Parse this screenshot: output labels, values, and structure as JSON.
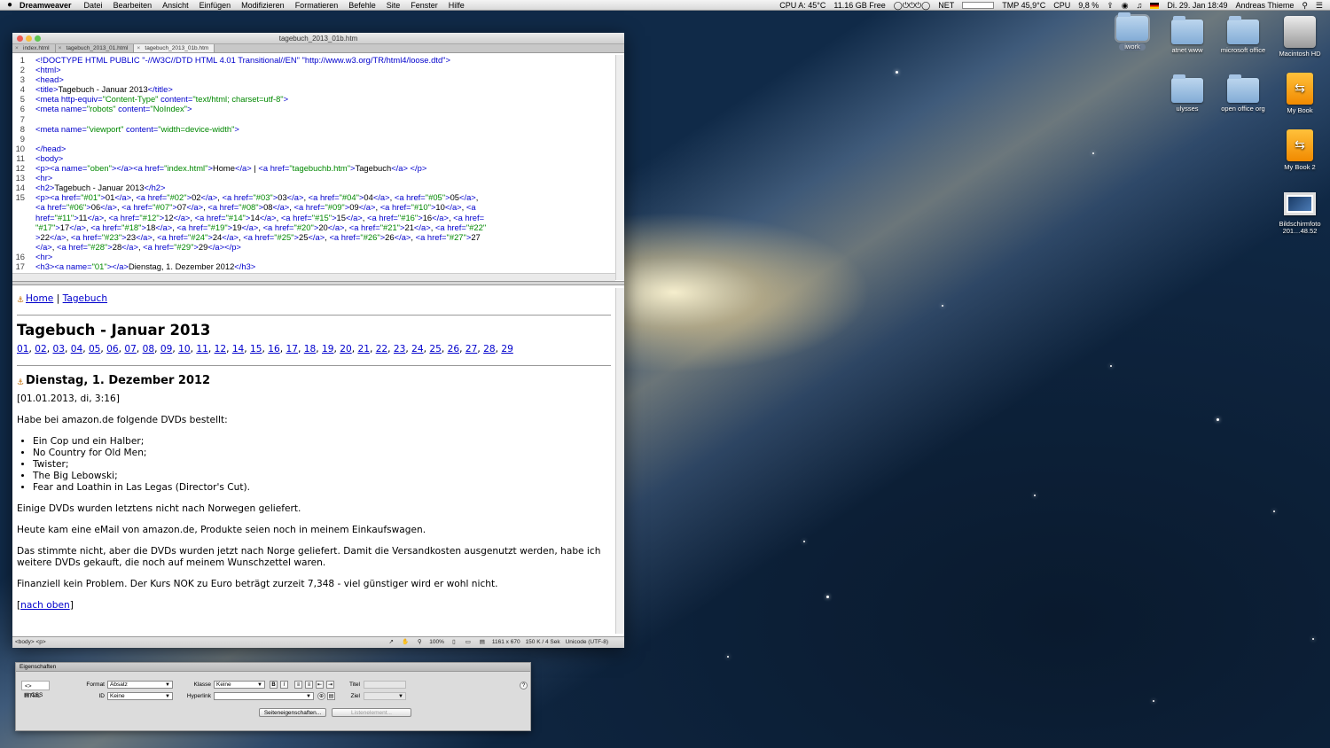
{
  "menubar": {
    "app": "Dreamweaver",
    "items": [
      "Datei",
      "Bearbeiten",
      "Ansicht",
      "Einfügen",
      "Modifizieren",
      "Formatieren",
      "Befehle",
      "Site",
      "Fenster",
      "Hilfe"
    ],
    "status": {
      "cpu_temp": "CPU A: 45°C",
      "disk_free": "11.16 GB Free",
      "net": "NET",
      "tmp": "TMP 45,9°C",
      "cpu": "CPU",
      "cpu_pct": "9,8 %",
      "datetime": "Di. 29. Jan 18:49",
      "user": "Andreas Thieme"
    }
  },
  "desktop": {
    "icons": [
      {
        "label": "iwork",
        "type": "folder",
        "selected": true
      },
      {
        "label": "atnet www",
        "type": "folder"
      },
      {
        "label": "microsoft office",
        "type": "folder"
      },
      {
        "label": "Macintosh HD",
        "type": "drive"
      },
      {
        "label": "ulysses",
        "type": "folder"
      },
      {
        "label": "open office org",
        "type": "folder"
      },
      {
        "label": "My Book",
        "type": "external"
      },
      {
        "label": "My Book 2",
        "type": "external"
      },
      {
        "label": "Bildschirmfoto 201…48.52",
        "type": "screenshot"
      }
    ]
  },
  "window": {
    "title": "tagebuch_2013_01b.htm",
    "tabs": [
      {
        "label": "index.html",
        "active": false
      },
      {
        "label": "tagebuch_2013_01.html",
        "active": false
      },
      {
        "label": "tagebuch_2013_01b.htm",
        "active": true
      }
    ],
    "code_lines": [
      {
        "n": "1",
        "segs": [
          [
            "t",
            "<!DOCTYPE HTML PUBLIC \"-//W3C//DTD HTML 4.01 Transitional//EN\" \"http://www.w3.org/TR/html4/loose.dtd\">"
          ]
        ]
      },
      {
        "n": "2",
        "segs": [
          [
            "t",
            "<html>"
          ]
        ]
      },
      {
        "n": "3",
        "segs": [
          [
            "t",
            "<head>"
          ]
        ]
      },
      {
        "n": "4",
        "segs": [
          [
            "t",
            "<title>"
          ],
          [
            "x",
            "Tagebuch - Januar 2013"
          ],
          [
            "t",
            "</title>"
          ]
        ]
      },
      {
        "n": "5",
        "segs": [
          [
            "t",
            "<meta http-equiv="
          ],
          [
            "s",
            "\"Content-Type\""
          ],
          [
            "t",
            " content="
          ],
          [
            "s",
            "\"text/html; charset=utf-8\""
          ],
          [
            "t",
            ">"
          ]
        ]
      },
      {
        "n": "6",
        "segs": [
          [
            "t",
            "<meta name="
          ],
          [
            "s",
            "\"robots\""
          ],
          [
            "t",
            " content="
          ],
          [
            "s",
            "\"NoIndex\""
          ],
          [
            "t",
            ">"
          ]
        ]
      },
      {
        "n": "7",
        "segs": []
      },
      {
        "n": "8",
        "segs": [
          [
            "t",
            "<meta name="
          ],
          [
            "s",
            "\"viewport\""
          ],
          [
            "t",
            " content="
          ],
          [
            "s",
            "\"width=device-width\""
          ],
          [
            "t",
            ">"
          ]
        ]
      },
      {
        "n": "9",
        "segs": []
      },
      {
        "n": "10",
        "segs": [
          [
            "t",
            "</head>"
          ]
        ]
      },
      {
        "n": "11",
        "segs": [
          [
            "t",
            "<body>"
          ]
        ]
      },
      {
        "n": "12",
        "segs": [
          [
            "t",
            "<p><a name="
          ],
          [
            "s",
            "\"oben\""
          ],
          [
            "t",
            "></a><a href="
          ],
          [
            "s",
            "\"index.html\""
          ],
          [
            "t",
            ">"
          ],
          [
            "x",
            "Home"
          ],
          [
            "t",
            "</a>"
          ],
          [
            "x",
            " | "
          ],
          [
            "t",
            "<a href="
          ],
          [
            "s",
            "\"tagebuchb.htm\""
          ],
          [
            "t",
            ">"
          ],
          [
            "x",
            "Tagebuch"
          ],
          [
            "t",
            "</a> </p>"
          ]
        ]
      },
      {
        "n": "13",
        "segs": [
          [
            "t",
            "<hr>"
          ]
        ]
      },
      {
        "n": "14",
        "segs": [
          [
            "t",
            "<h2>"
          ],
          [
            "x",
            "Tagebuch - Januar 2013"
          ],
          [
            "t",
            "</h2>"
          ]
        ]
      },
      {
        "n": "15",
        "segs": [
          [
            "t",
            "<p><a href="
          ],
          [
            "s",
            "\"#01\""
          ],
          [
            "t",
            ">"
          ],
          [
            "x",
            "01"
          ],
          [
            "t",
            "</a>"
          ],
          [
            "x",
            ", "
          ],
          [
            "t",
            "<a href="
          ],
          [
            "s",
            "\"#02\""
          ],
          [
            "t",
            ">"
          ],
          [
            "x",
            "02"
          ],
          [
            "t",
            "</a>"
          ],
          [
            "x",
            ", "
          ],
          [
            "t",
            "<a href="
          ],
          [
            "s",
            "\"#03\""
          ],
          [
            "t",
            ">"
          ],
          [
            "x",
            "03"
          ],
          [
            "t",
            "</a>"
          ],
          [
            "x",
            ", "
          ],
          [
            "t",
            "<a href="
          ],
          [
            "s",
            "\"#04\""
          ],
          [
            "t",
            ">"
          ],
          [
            "x",
            "04"
          ],
          [
            "t",
            "</a>"
          ],
          [
            "x",
            ", "
          ],
          [
            "t",
            "<a href="
          ],
          [
            "s",
            "\"#05\""
          ],
          [
            "t",
            ">"
          ],
          [
            "x",
            "05"
          ],
          [
            "t",
            "</a>"
          ],
          [
            "x",
            ","
          ]
        ]
      },
      {
        "n": "",
        "segs": [
          [
            "t",
            "<a href="
          ],
          [
            "s",
            "\"#06\""
          ],
          [
            "t",
            ">"
          ],
          [
            "x",
            "06"
          ],
          [
            "t",
            "</a>"
          ],
          [
            "x",
            ", "
          ],
          [
            "t",
            "<a href="
          ],
          [
            "s",
            "\"#07\""
          ],
          [
            "t",
            ">"
          ],
          [
            "x",
            "07"
          ],
          [
            "t",
            "</a>"
          ],
          [
            "x",
            ", "
          ],
          [
            "t",
            "<a href="
          ],
          [
            "s",
            "\"#08\""
          ],
          [
            "t",
            ">"
          ],
          [
            "x",
            "08"
          ],
          [
            "t",
            "</a>"
          ],
          [
            "x",
            ", "
          ],
          [
            "t",
            "<a href="
          ],
          [
            "s",
            "\"#09\""
          ],
          [
            "t",
            ">"
          ],
          [
            "x",
            "09"
          ],
          [
            "t",
            "</a>"
          ],
          [
            "x",
            ", "
          ],
          [
            "t",
            "<a href="
          ],
          [
            "s",
            "\"#10\""
          ],
          [
            "t",
            ">"
          ],
          [
            "x",
            "10"
          ],
          [
            "t",
            "</a>"
          ],
          [
            "x",
            ", "
          ],
          [
            "t",
            "<a"
          ]
        ]
      },
      {
        "n": "",
        "segs": [
          [
            "t",
            "href="
          ],
          [
            "s",
            "\"#11\""
          ],
          [
            "t",
            ">"
          ],
          [
            "x",
            "11"
          ],
          [
            "t",
            "</a>"
          ],
          [
            "x",
            ", "
          ],
          [
            "t",
            "<a href="
          ],
          [
            "s",
            "\"#12\""
          ],
          [
            "t",
            ">"
          ],
          [
            "x",
            "12"
          ],
          [
            "t",
            "</a>"
          ],
          [
            "x",
            ", "
          ],
          [
            "t",
            "<a href="
          ],
          [
            "s",
            "\"#14\""
          ],
          [
            "t",
            ">"
          ],
          [
            "x",
            "14"
          ],
          [
            "t",
            "</a>"
          ],
          [
            "x",
            ", "
          ],
          [
            "t",
            "<a href="
          ],
          [
            "s",
            "\"#15\""
          ],
          [
            "t",
            ">"
          ],
          [
            "x",
            "15"
          ],
          [
            "t",
            "</a>"
          ],
          [
            "x",
            ", "
          ],
          [
            "t",
            "<a href="
          ],
          [
            "s",
            "\"#16\""
          ],
          [
            "t",
            ">"
          ],
          [
            "x",
            "16"
          ],
          [
            "t",
            "</a>"
          ],
          [
            "x",
            ", "
          ],
          [
            "t",
            "<a href="
          ]
        ]
      },
      {
        "n": "",
        "segs": [
          [
            "s",
            "\"#17\""
          ],
          [
            "t",
            ">"
          ],
          [
            "x",
            "17"
          ],
          [
            "t",
            "</a>"
          ],
          [
            "x",
            ", "
          ],
          [
            "t",
            "<a href="
          ],
          [
            "s",
            "\"#18\""
          ],
          [
            "t",
            ">"
          ],
          [
            "x",
            "18"
          ],
          [
            "t",
            "</a>"
          ],
          [
            "x",
            ", "
          ],
          [
            "t",
            "<a href="
          ],
          [
            "s",
            "\"#19\""
          ],
          [
            "t",
            ">"
          ],
          [
            "x",
            "19"
          ],
          [
            "t",
            "</a>"
          ],
          [
            "x",
            ", "
          ],
          [
            "t",
            "<a href="
          ],
          [
            "s",
            "\"#20\""
          ],
          [
            "t",
            ">"
          ],
          [
            "x",
            "20"
          ],
          [
            "t",
            "</a>"
          ],
          [
            "x",
            ", "
          ],
          [
            "t",
            "<a href="
          ],
          [
            "s",
            "\"#21\""
          ],
          [
            "t",
            ">"
          ],
          [
            "x",
            "21"
          ],
          [
            "t",
            "</a>"
          ],
          [
            "x",
            ", "
          ],
          [
            "t",
            "<a href="
          ],
          [
            "s",
            "\"#22\""
          ]
        ]
      },
      {
        "n": "",
        "segs": [
          [
            "t",
            ">"
          ],
          [
            "x",
            "22"
          ],
          [
            "t",
            "</a>"
          ],
          [
            "x",
            ", "
          ],
          [
            "t",
            "<a href="
          ],
          [
            "s",
            "\"#23\""
          ],
          [
            "t",
            ">"
          ],
          [
            "x",
            "23"
          ],
          [
            "t",
            "</a>"
          ],
          [
            "x",
            ", "
          ],
          [
            "t",
            "<a href="
          ],
          [
            "s",
            "\"#24\""
          ],
          [
            "t",
            ">"
          ],
          [
            "x",
            "24"
          ],
          [
            "t",
            "</a>"
          ],
          [
            "x",
            ", "
          ],
          [
            "t",
            "<a href="
          ],
          [
            "s",
            "\"#25\""
          ],
          [
            "t",
            ">"
          ],
          [
            "x",
            "25"
          ],
          [
            "t",
            "</a>"
          ],
          [
            "x",
            ", "
          ],
          [
            "t",
            "<a href="
          ],
          [
            "s",
            "\"#26\""
          ],
          [
            "t",
            ">"
          ],
          [
            "x",
            "26"
          ],
          [
            "t",
            "</a>"
          ],
          [
            "x",
            ", "
          ],
          [
            "t",
            "<a href="
          ],
          [
            "s",
            "\"#27\""
          ],
          [
            "t",
            ">"
          ],
          [
            "x",
            "27"
          ]
        ]
      },
      {
        "n": "",
        "segs": [
          [
            "t",
            "</a>"
          ],
          [
            "x",
            ", "
          ],
          [
            "t",
            "<a href="
          ],
          [
            "s",
            "\"#28\""
          ],
          [
            "t",
            ">"
          ],
          [
            "x",
            "28"
          ],
          [
            "t",
            "</a>"
          ],
          [
            "x",
            ", "
          ],
          [
            "t",
            "<a href="
          ],
          [
            "s",
            "\"#29\""
          ],
          [
            "t",
            ">"
          ],
          [
            "x",
            "29"
          ],
          [
            "t",
            "</a></p>"
          ]
        ]
      },
      {
        "n": "16",
        "segs": [
          [
            "t",
            "<hr>"
          ]
        ]
      },
      {
        "n": "17",
        "segs": [
          [
            "t",
            "<h3><a name="
          ],
          [
            "s",
            "\"01\""
          ],
          [
            "t",
            "></a>"
          ],
          [
            "x",
            "Dienstag, 1. Dezember 2012"
          ],
          [
            "t",
            "</h3>"
          ]
        ]
      }
    ],
    "design": {
      "nav_home": "Home",
      "nav_sep": "|",
      "nav_tagebuch": "Tagebuch",
      "heading": "Tagebuch - Januar 2013",
      "days": [
        "01",
        "02",
        "03",
        "04",
        "05",
        "06",
        "07",
        "08",
        "09",
        "10",
        "11",
        "12",
        "14",
        "15",
        "16",
        "17",
        "18",
        "19",
        "20",
        "21",
        "22",
        "23",
        "24",
        "25",
        "26",
        "27",
        "28",
        "29"
      ],
      "entry_heading": "Dienstag, 1. Dezember 2012",
      "timestamp": "[01.01.2013, di, 3:16]",
      "p1": "Habe bei amazon.de folgende DVDs bestellt:",
      "dvds": [
        "Ein Cop und ein Halber;",
        "No Country for Old Men;",
        "Twister;",
        "The Big Lebowski;",
        "Fear and Loathin in Las Legas (Director's Cut)."
      ],
      "p2": "Einige DVDs wurden letztens nicht nach Norwegen geliefert.",
      "p3": "Heute kam eine eMail von amazon.de, Produkte seien noch in meinem Einkaufswagen.",
      "p4": "Das stimmte nicht, aber die DVDs wurden jetzt nach Norge geliefert. Damit die Versandkosten ausgenutzt werden, habe ich weitere DVDs gekauft, die noch auf meinem Wunschzettel waren.",
      "p5": "Finanziell kein Problem. Der Kurs NOK zu Euro beträgt zurzeit 7,348 - viel günstiger wird er wohl nicht.",
      "back_open": "[",
      "back_link": "nach oben",
      "back_close": "]"
    },
    "status": {
      "tags": "<body> <p>",
      "zoom": "100%",
      "dims": "1161 x 670",
      "size": "150 K / 4 Sek",
      "encoding": "Unicode (UTF-8)"
    }
  },
  "properties": {
    "title": "Eigenschaften",
    "html_label": "HTML",
    "css_label": "CSS",
    "format_label": "Format",
    "format_value": "Absatz",
    "id_label": "ID",
    "id_value": "Keine",
    "class_label": "Klasse",
    "class_value": "Keine",
    "hyperlink_label": "Hyperlink",
    "hyperlink_value": "",
    "title_label": "Titel",
    "target_label": "Ziel",
    "page_props_button": "Seiteneigenschaften...",
    "list_item_button": "Listenelement..."
  },
  "colors": {
    "tag": "#0000cc",
    "string": "#008800",
    "link": "#0000cc"
  }
}
